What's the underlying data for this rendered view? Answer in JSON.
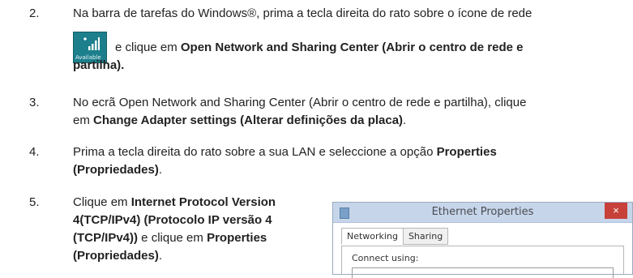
{
  "steps": [
    {
      "number": "2.",
      "line1": "Na barra de tarefas do Windows®, prima a tecla direita do rato sobre o ícone de rede",
      "line2_pre": "e clique em ",
      "line2_bold": "Open Network and Sharing Center (Abrir o centro de rede e",
      "line3_bold": "partilha)."
    },
    {
      "number": "3.",
      "line1": "No ecrã Open Network and Sharing Center (Abrir o centro de rede e partilha), clique",
      "line2_pre": "em ",
      "line2_bold": "Change Adapter settings (Alterar definições da placa)",
      "line2_post": "."
    },
    {
      "number": "4.",
      "line1_pre": "Prima a tecla direita do rato sobre a sua LAN e seleccione a opção ",
      "line1_bold": "Properties",
      "line2_bold": "(Propriedades)",
      "line2_post": "."
    },
    {
      "number": "5.",
      "line1_pre": "Clique em ",
      "line1_bold": "Internet Protocol Version",
      "line2_bold": "4(TCP/IPv4) (Protocolo IP versão 4",
      "line3_bold": "(TCP/IPv4))",
      "line3_mid": " e clique em ",
      "line3_bold2": "Properties",
      "line4_bold": "(Propriedades)",
      "line4_post": "."
    }
  ],
  "network_icon": {
    "icon": "wifi-signal-icon",
    "label": "Available",
    "color": "#1d7f8c"
  },
  "dialog": {
    "title": "Ethernet Properties",
    "close_glyph": "×",
    "tabs": [
      "Networking",
      "Sharing"
    ],
    "connect_using_label": "Connect using:"
  }
}
